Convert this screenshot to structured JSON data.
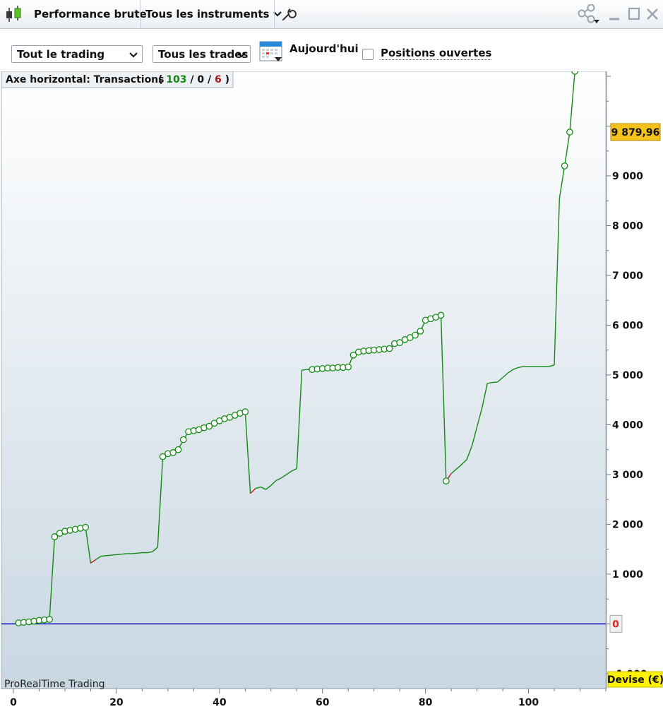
{
  "titlebar": {
    "title": "Performance brute",
    "instruments_label": "Tous les instruments"
  },
  "toolbar": {
    "trading_select": "Tout le trading",
    "trades_select": "Tous les trades",
    "date_label": "Aujourd'hui",
    "open_positions_label": "Positions ouvertes"
  },
  "colors": {
    "equity_line": "#138a13",
    "loss_segment": "#c01717",
    "zero_line": "#1010c0",
    "last_value_bg": "#f5c11c",
    "currency_bg": "#fff200"
  },
  "chart_data": {
    "type": "line",
    "header_label": "Axe horizontal: Transactions",
    "trade_counts": {
      "winning": "103",
      "neutral": "0",
      "losing": "6"
    },
    "xlabel": "",
    "ylabel": "",
    "currency_label": "Devise (€)",
    "last_value_label": "9 879,96",
    "zero_label": "0",
    "watermark": "ProRealTime Trading",
    "xlim": [
      0,
      115
    ],
    "ylim": [
      -1300,
      11100
    ],
    "x_ticks": [
      0,
      20,
      40,
      60,
      80,
      100
    ],
    "x_tick_labels": [
      "0",
      "20",
      "40",
      "60",
      "80",
      "100"
    ],
    "y_ticks": [
      -1000,
      1000,
      2000,
      3000,
      4000,
      5000,
      6000,
      7000,
      8000,
      9000
    ],
    "y_tick_labels": [
      "-1 000",
      "1 000",
      "2 000",
      "3 000",
      "4 000",
      "5 000",
      "6 000",
      "7 000",
      "8 000",
      "9 000"
    ],
    "grid": false,
    "x": [
      1,
      2,
      3,
      4,
      5,
      6,
      7,
      8,
      9,
      10,
      11,
      12,
      13,
      14,
      15,
      16,
      17,
      18,
      19,
      20,
      21,
      22,
      23,
      24,
      25,
      26,
      27,
      28,
      29,
      30,
      31,
      32,
      33,
      34,
      35,
      36,
      37,
      38,
      39,
      40,
      41,
      42,
      43,
      44,
      45,
      46,
      47,
      48,
      49,
      50,
      51,
      52,
      53,
      54,
      55,
      56,
      57,
      58,
      59,
      60,
      61,
      62,
      63,
      64,
      65,
      66,
      67,
      68,
      69,
      70,
      71,
      72,
      73,
      74,
      75,
      76,
      77,
      78,
      79,
      80,
      81,
      82,
      83,
      84,
      85,
      86,
      87,
      88,
      89,
      90,
      91,
      92,
      93,
      94,
      95,
      96,
      97,
      98,
      99,
      100,
      101,
      102,
      103,
      104,
      105,
      106,
      107,
      108,
      109
    ],
    "equity": [
      20,
      30,
      40,
      55,
      70,
      80,
      90,
      1750,
      1820,
      1860,
      1880,
      1900,
      1920,
      1940,
      1220,
      1290,
      1360,
      1370,
      1380,
      1390,
      1400,
      1410,
      1410,
      1420,
      1430,
      1430,
      1450,
      1540,
      3360,
      3420,
      3440,
      3500,
      3700,
      3860,
      3880,
      3900,
      3940,
      3970,
      4030,
      4080,
      4120,
      4150,
      4190,
      4230,
      4260,
      2620,
      2720,
      2750,
      2700,
      2780,
      2880,
      2930,
      3000,
      3070,
      3120,
      5100,
      5110,
      5110,
      5120,
      5130,
      5140,
      5140,
      5150,
      5150,
      5160,
      5400,
      5460,
      5480,
      5490,
      5500,
      5510,
      5520,
      5530,
      5630,
      5650,
      5710,
      5750,
      5800,
      5880,
      6100,
      6130,
      6160,
      6200,
      2870,
      3020,
      3110,
      3200,
      3300,
      3570,
      3960,
      4350,
      4830,
      4850,
      4860,
      4950,
      5040,
      5110,
      5150,
      5170,
      5170,
      5170,
      5170,
      5170,
      5170,
      5200,
      8550,
      9200,
      9879.96
    ],
    "loss_indices": [
      14,
      45,
      83
    ],
    "markers": [
      1,
      2,
      3,
      4,
      5,
      6,
      7,
      8,
      9,
      10,
      11,
      12,
      13,
      14,
      29,
      30,
      31,
      32,
      33,
      34,
      35,
      36,
      37,
      38,
      39,
      40,
      41,
      42,
      43,
      44,
      45,
      58,
      59,
      60,
      61,
      62,
      63,
      64,
      65,
      66,
      67,
      68,
      69,
      70,
      71,
      72,
      73,
      74,
      75,
      76,
      77,
      78,
      79,
      80,
      81,
      82,
      83,
      84,
      107,
      108,
      109
    ]
  }
}
